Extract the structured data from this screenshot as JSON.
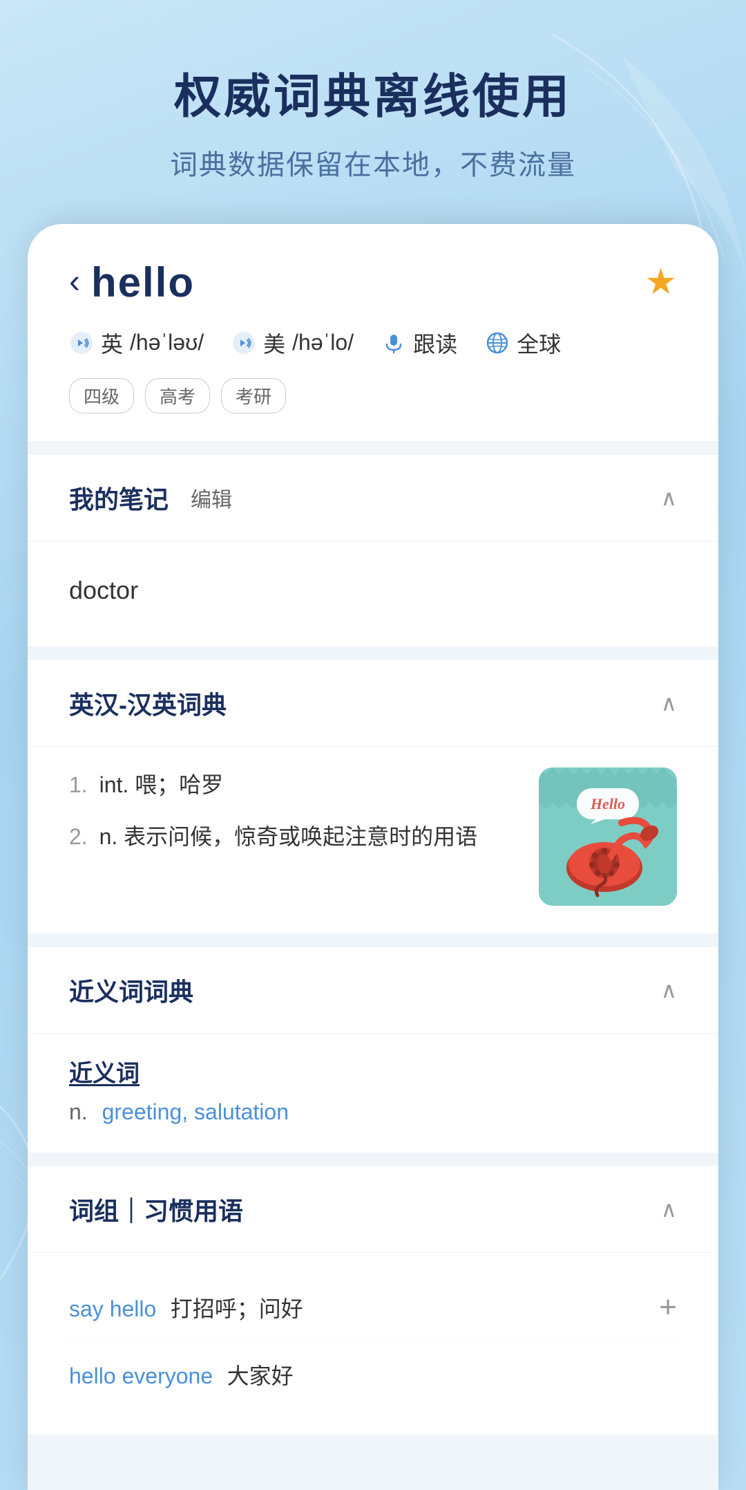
{
  "header": {
    "title": "权威词典离线使用",
    "subtitle": "词典数据保留在本地，不费流量"
  },
  "word_card": {
    "back_label": "‹",
    "word": "hello",
    "star_filled": true,
    "british": {
      "label": "英",
      "phonetic": "/həˈləʊ/"
    },
    "american": {
      "label": "美",
      "phonetic": "/həˈlo/"
    },
    "follow_read": "跟读",
    "global": "全球",
    "tags": [
      "四级",
      "高考",
      "考研"
    ]
  },
  "sections": {
    "notes": {
      "title": "我的笔记",
      "edit_label": "编辑",
      "content": "doctor"
    },
    "dictionary": {
      "title": "英汉-汉英词典",
      "definitions": [
        {
          "num": "1.",
          "text": "int. 喂；哈罗"
        },
        {
          "num": "2.",
          "text": "n. 表示问候，惊奇或唤起注意时的用语"
        }
      ]
    },
    "synonyms": {
      "title": "近义词词典",
      "label": "近义词",
      "pos": "n.",
      "words": "greeting, salutation"
    },
    "phrases": {
      "title": "词组｜习惯用语",
      "items": [
        {
          "phrase": "say hello",
          "meaning": "打招呼；问好",
          "has_add": true
        },
        {
          "phrase": "hello everyone",
          "meaning": "大家好",
          "has_add": false
        }
      ]
    }
  }
}
